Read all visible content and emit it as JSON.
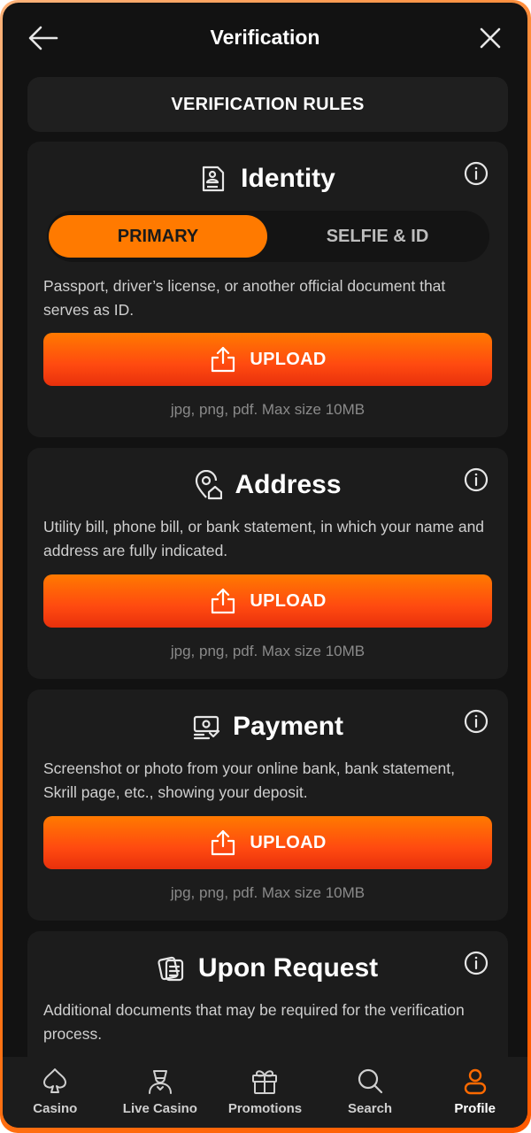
{
  "header": {
    "title": "Verification",
    "back_icon": "arrow-left-icon",
    "close_icon": "close-icon"
  },
  "rules_button": "VERIFICATION RULES",
  "cards": [
    {
      "title": "Identity",
      "icon": "id-document-icon",
      "tabs": [
        "PRIMARY",
        "SELFIE & ID"
      ],
      "active_tab": "PRIMARY",
      "description": "Passport, driver’s license, or another official document that serves as ID.",
      "upload_label": "UPLOAD",
      "formats": "jpg, png, pdf. Max size 10MB"
    },
    {
      "title": "Address",
      "icon": "location-home-icon",
      "description": "Utility bill, phone bill, or bank statement, in which your name and address are fully indicated.",
      "upload_label": "UPLOAD",
      "formats": "jpg, png, pdf. Max size 10MB"
    },
    {
      "title": "Payment",
      "icon": "payment-icon",
      "description": "Screenshot or photo from your online bank, bank statement, Skrill page, etc., showing your deposit.",
      "upload_label": "UPLOAD",
      "formats": "jpg, png, pdf. Max size 10MB"
    },
    {
      "title": "Upon Request",
      "icon": "documents-icon",
      "description": "Additional documents that may be required for the verification process."
    }
  ],
  "bottom_nav": [
    {
      "label": "Casino",
      "icon": "spade-icon",
      "active": false
    },
    {
      "label": "Live Casino",
      "icon": "dealer-icon",
      "active": false
    },
    {
      "label": "Promotions",
      "icon": "gift-icon",
      "active": false
    },
    {
      "label": "Search",
      "icon": "search-icon",
      "active": false
    },
    {
      "label": "Profile",
      "icon": "user-icon",
      "active": true
    }
  ],
  "colors": {
    "accent": "#ff7a00",
    "accent_dark": "#e8300c",
    "background": "#121212",
    "card": "#1c1c1c"
  }
}
